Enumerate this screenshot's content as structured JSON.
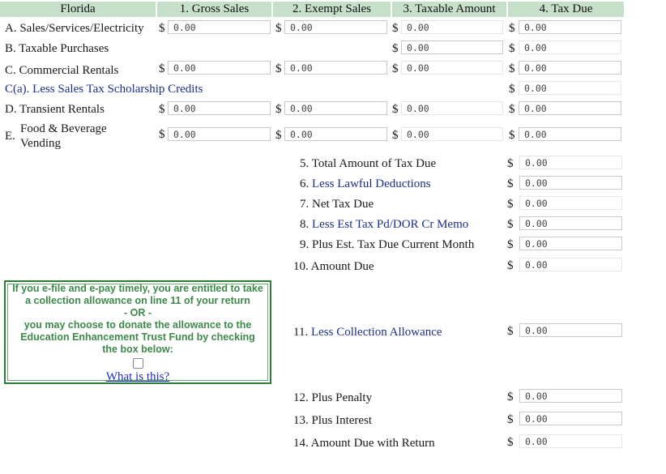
{
  "headers": {
    "state": "Florida",
    "col1": "1. Gross Sales",
    "col2": "2. Exempt Sales",
    "col3": "3. Taxable Amount",
    "col4": "4. Tax Due"
  },
  "currency_symbol": "$",
  "rows": {
    "a": {
      "label": "A. Sales/Services/Electricity",
      "gross": "0.00",
      "exempt": "0.00",
      "taxable": "0.00",
      "tax": "0.00"
    },
    "b": {
      "label": "B. Taxable Purchases",
      "taxable": "0.00",
      "tax": "0.00"
    },
    "c": {
      "label": "C. Commercial Rentals",
      "gross": "0.00",
      "exempt": "0.00",
      "taxable": "0.00",
      "tax": "0.00"
    },
    "ca": {
      "label": "C(a). Less Sales Tax Scholarship Credits",
      "tax": "0.00"
    },
    "d": {
      "label": "D. Transient Rentals",
      "gross": "0.00",
      "exempt": "0.00",
      "taxable": "0.00",
      "tax": "0.00"
    },
    "e": {
      "prefix": "E.",
      "label_line1": "Food & Beverage",
      "label_line2": "Vending",
      "gross": "0.00",
      "exempt": "0.00",
      "taxable": "0.00",
      "tax": "0.00"
    }
  },
  "totals": {
    "line5": {
      "label": "5. Total Amount of Tax Due",
      "value": "0.00"
    },
    "line6": {
      "label_num": "6.",
      "label": "Less Lawful Deductions",
      "value": "0.00"
    },
    "line7": {
      "label": "7. Net Tax Due",
      "value": "0.00"
    },
    "line8": {
      "label_num": "8.",
      "label": "Less Est Tax Pd/DOR Cr Memo",
      "value": "0.00"
    },
    "line9": {
      "label": "9. Plus Est. Tax Due Current Month",
      "value": "0.00"
    },
    "line10": {
      "label": "10. Amount Due",
      "value": "0.00"
    },
    "line11": {
      "label_num": "11.",
      "label": "Less Collection Allowance",
      "value": "0.00"
    },
    "line12": {
      "label": "12. Plus Penalty",
      "value": "0.00"
    },
    "line13": {
      "label": "13. Plus Interest",
      "value": "0.00"
    },
    "line14": {
      "label": "14. Amount Due with Return",
      "value": "0.00"
    }
  },
  "allowance_box": {
    "line1": "If you e-file and e-pay timely, you are entitled to take",
    "line2": "a collection allowance on line 11 of your return",
    "line3": "- OR -",
    "line4": "you may choose to donate the allowance to the",
    "line5": "Education Enhancement Trust Fund by checking",
    "line6": "the box below:",
    "link": "What is this?",
    "donate_checked": false
  },
  "colors": {
    "header_bg": "#c6e0c9",
    "link_label": "#1b2f8a",
    "box_border": "#2f7a38",
    "box_text": "#3d8a4a"
  }
}
